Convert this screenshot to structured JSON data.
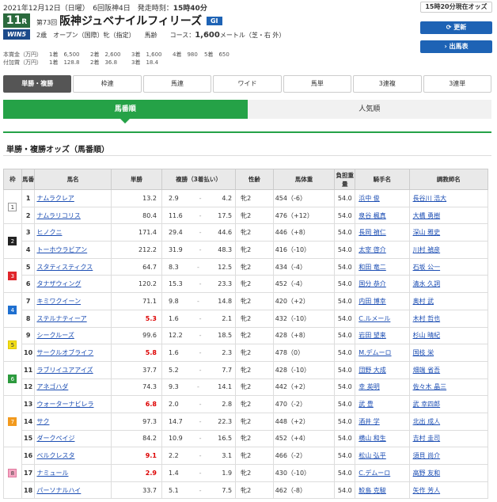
{
  "header": {
    "date_line": "2021年12月12日（日曜）　6回阪神4日　発走時刻：",
    "post_time": "15時40分",
    "odds_time": "15時20分現在オッズ",
    "race_no": "11",
    "race_no_suffix": "R",
    "wins_logo": "WIN5",
    "kai": "第73回",
    "race_name": "阪神ジュベナイルフィリーズ",
    "grade": "GI",
    "conditions": "2歳　オープン（国際）牝（指定）　　馬齢　　コース：",
    "distance": "1,600",
    "course_tail": "メートル（芝・右 外）",
    "update_button": "更新",
    "shutsuba_button": "出馬表"
  },
  "prize_rows": [
    {
      "label": "本賞金（万円）",
      "items": [
        "1着　6,500",
        "2着　2,600",
        "3着　1,600",
        "4着　980",
        "5着　650"
      ]
    },
    {
      "label": "付加賞（万円）",
      "items": [
        "1着　128.8",
        "2着　36.8",
        "3着　18.4",
        "",
        ""
      ]
    }
  ],
  "tabs": [
    {
      "label": "単勝・複勝",
      "active": true
    },
    {
      "label": "枠連",
      "active": false
    },
    {
      "label": "馬連",
      "active": false
    },
    {
      "label": "ワイド",
      "active": false
    },
    {
      "label": "馬単",
      "active": false
    },
    {
      "label": "3連複",
      "active": false
    },
    {
      "label": "3連単",
      "active": false
    }
  ],
  "subtabs": [
    {
      "label": "馬番順",
      "active": true
    },
    {
      "label": "人気順",
      "active": false
    }
  ],
  "section_title": "単勝・複勝オッズ（馬番順）",
  "table": {
    "headers": [
      "枠",
      "馬番",
      "馬名",
      "単勝",
      "複勝（3着払い）",
      "性齢",
      "馬体重",
      "負担重量",
      "騎手名",
      "調教師名"
    ],
    "waku_colors": {
      "1": {
        "bg": "#ffffff",
        "fg": "#333333",
        "border": "#999999"
      },
      "2": {
        "bg": "#222222",
        "fg": "#ffffff",
        "border": "#222222"
      },
      "3": {
        "bg": "#e0262b",
        "fg": "#ffffff",
        "border": "#e0262b"
      },
      "4": {
        "bg": "#1e6fd0",
        "fg": "#ffffff",
        "border": "#1e6fd0"
      },
      "5": {
        "bg": "#f2de1a",
        "fg": "#333333",
        "border": "#e0c800"
      },
      "6": {
        "bg": "#2c9a3e",
        "fg": "#ffffff",
        "border": "#2c9a3e"
      },
      "7": {
        "bg": "#f29a1e",
        "fg": "#ffffff",
        "border": "#f29a1e"
      },
      "8": {
        "bg": "#f6a8c4",
        "fg": "#333333",
        "border": "#e07aa0"
      }
    },
    "rows": [
      {
        "waku": "1",
        "num": "1",
        "name": "ナムラクレア",
        "win": "13.2",
        "plc_lo": "2.9",
        "plc_hi": "4.2",
        "sex": "牝2",
        "weight": "454（-6）",
        "kin": "54.0",
        "jockey": "浜中 俊",
        "trainer": "長谷川 浩大",
        "fav": false
      },
      {
        "waku": "1",
        "num": "2",
        "name": "ナムラリコリス",
        "win": "80.4",
        "plc_lo": "11.6",
        "plc_hi": "17.5",
        "sex": "牝2",
        "weight": "476（+12）",
        "kin": "54.0",
        "jockey": "泉谷 楓真",
        "trainer": "大橋 勇樹",
        "fav": false
      },
      {
        "waku": "2",
        "num": "3",
        "name": "ヒノクニ",
        "win": "171.4",
        "plc_lo": "29.4",
        "plc_hi": "44.6",
        "sex": "牝2",
        "weight": "446（+8）",
        "kin": "54.0",
        "jockey": "長岡 禎仁",
        "trainer": "深山 雅史",
        "fav": false
      },
      {
        "waku": "2",
        "num": "4",
        "name": "トーホウラビアン",
        "win": "212.2",
        "plc_lo": "31.9",
        "plc_hi": "48.3",
        "sex": "牝2",
        "weight": "416（-10）",
        "kin": "54.0",
        "jockey": "太宰 啓介",
        "trainer": "川村 禎彦",
        "fav": false
      },
      {
        "waku": "3",
        "num": "5",
        "name": "スタティスティクス",
        "win": "64.7",
        "plc_lo": "8.3",
        "plc_hi": "12.5",
        "sex": "牝2",
        "weight": "434（-4）",
        "kin": "54.0",
        "jockey": "和田 竜二",
        "trainer": "石坂 公一",
        "fav": false
      },
      {
        "waku": "3",
        "num": "6",
        "name": "タナザウィング",
        "win": "120.2",
        "plc_lo": "15.3",
        "plc_hi": "23.3",
        "sex": "牝2",
        "weight": "452（-4）",
        "kin": "54.0",
        "jockey": "国分 恭介",
        "trainer": "清水 久詞",
        "fav": false
      },
      {
        "waku": "4",
        "num": "7",
        "name": "キミワクイーン",
        "win": "71.1",
        "plc_lo": "9.8",
        "plc_hi": "14.8",
        "sex": "牝2",
        "weight": "420（+2）",
        "kin": "54.0",
        "jockey": "内田 博幸",
        "trainer": "奥村 武",
        "fav": false
      },
      {
        "waku": "4",
        "num": "8",
        "name": "ステルナティーア",
        "win": "5.3",
        "plc_lo": "1.6",
        "plc_hi": "2.1",
        "sex": "牝2",
        "weight": "432（-10）",
        "kin": "54.0",
        "jockey": "C.ルメール",
        "trainer": "木村 哲也",
        "fav": true
      },
      {
        "waku": "5",
        "num": "9",
        "name": "シークルーズ",
        "win": "99.6",
        "plc_lo": "12.2",
        "plc_hi": "18.5",
        "sex": "牝2",
        "weight": "428（+8）",
        "kin": "54.0",
        "jockey": "岩田 望来",
        "trainer": "杉山 晴紀",
        "fav": false
      },
      {
        "waku": "5",
        "num": "10",
        "name": "サークルオブライフ",
        "win": "5.8",
        "plc_lo": "1.6",
        "plc_hi": "2.3",
        "sex": "牝2",
        "weight": "478（0）",
        "kin": "54.0",
        "jockey": "M.デムーロ",
        "trainer": "国枝 栄",
        "fav": true
      },
      {
        "waku": "6",
        "num": "11",
        "name": "ラブリイユアアイズ",
        "win": "37.7",
        "plc_lo": "5.2",
        "plc_hi": "7.7",
        "sex": "牝2",
        "weight": "428（-10）",
        "kin": "54.0",
        "jockey": "団野 大成",
        "trainer": "畑端 省吾",
        "fav": false
      },
      {
        "waku": "6",
        "num": "12",
        "name": "アネゴハダ",
        "win": "74.3",
        "plc_lo": "9.3",
        "plc_hi": "14.1",
        "sex": "牝2",
        "weight": "442（+2）",
        "kin": "54.0",
        "jockey": "幸 英明",
        "trainer": "佐々木 晶三",
        "fav": false
      },
      {
        "waku": "7",
        "num": "13",
        "name": "ウォーターナビレラ",
        "win": "6.8",
        "plc_lo": "2.0",
        "plc_hi": "2.8",
        "sex": "牝2",
        "weight": "470（-2）",
        "kin": "54.0",
        "jockey": "武 豊",
        "trainer": "武 幸四郎",
        "fav": true
      },
      {
        "waku": "7",
        "num": "14",
        "name": "サク",
        "win": "97.3",
        "plc_lo": "14.7",
        "plc_hi": "22.3",
        "sex": "牝2",
        "weight": "448（+2）",
        "kin": "54.0",
        "jockey": "酒井 学",
        "trainer": "北出 成人",
        "fav": false
      },
      {
        "waku": "7",
        "num": "15",
        "name": "ダークペイジ",
        "win": "84.2",
        "plc_lo": "10.9",
        "plc_hi": "16.5",
        "sex": "牝2",
        "weight": "452（+4）",
        "kin": "54.0",
        "jockey": "横山 和生",
        "trainer": "吉村 圭司",
        "fav": false
      },
      {
        "waku": "8",
        "num": "16",
        "name": "ベルクレスタ",
        "win": "9.1",
        "plc_lo": "2.2",
        "plc_hi": "3.1",
        "sex": "牝2",
        "weight": "466（-2）",
        "kin": "54.0",
        "jockey": "松山 弘平",
        "trainer": "須貝 尚介",
        "fav": true
      },
      {
        "waku": "8",
        "num": "17",
        "name": "ナミュール",
        "win": "2.9",
        "plc_lo": "1.4",
        "plc_hi": "1.9",
        "sex": "牝2",
        "weight": "430（-10）",
        "kin": "54.0",
        "jockey": "C.デムーロ",
        "trainer": "高野 友和",
        "fav": true
      },
      {
        "waku": "8",
        "num": "18",
        "name": "パーソナルハイ",
        "win": "33.7",
        "plc_lo": "5.1",
        "plc_hi": "7.5",
        "sex": "牝2",
        "weight": "462（-8）",
        "kin": "54.0",
        "jockey": "鮫島 克駿",
        "trainer": "矢作 芳人",
        "fav": false
      }
    ]
  }
}
